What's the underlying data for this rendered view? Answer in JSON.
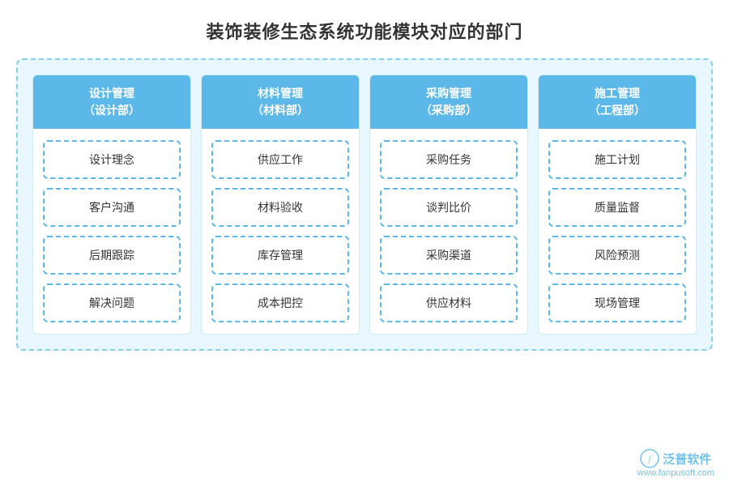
{
  "title": "装饰装修生态系统功能模块对应的部门",
  "columns": [
    {
      "id": "design",
      "header_line1": "设计管理",
      "header_line2": "（设计部）",
      "items": [
        "设计理念",
        "客户沟通",
        "后期跟踪",
        "解决问题"
      ]
    },
    {
      "id": "material",
      "header_line1": "材料管理",
      "header_line2": "（材料部）",
      "items": [
        "供应工作",
        "材料验收",
        "库存管理",
        "成本把控"
      ]
    },
    {
      "id": "purchase",
      "header_line1": "采购管理",
      "header_line2": "（采购部）",
      "items": [
        "采购任务",
        "谈判比价",
        "采购渠道",
        "供应材料"
      ]
    },
    {
      "id": "construction",
      "header_line1": "施工管理",
      "header_line2": "（工程部）",
      "items": [
        "施工计划",
        "质量监督",
        "风险预测",
        "现场管理"
      ]
    }
  ],
  "watermark": {
    "brand": "泛普软件",
    "url": "www.fanpusoft.com"
  }
}
